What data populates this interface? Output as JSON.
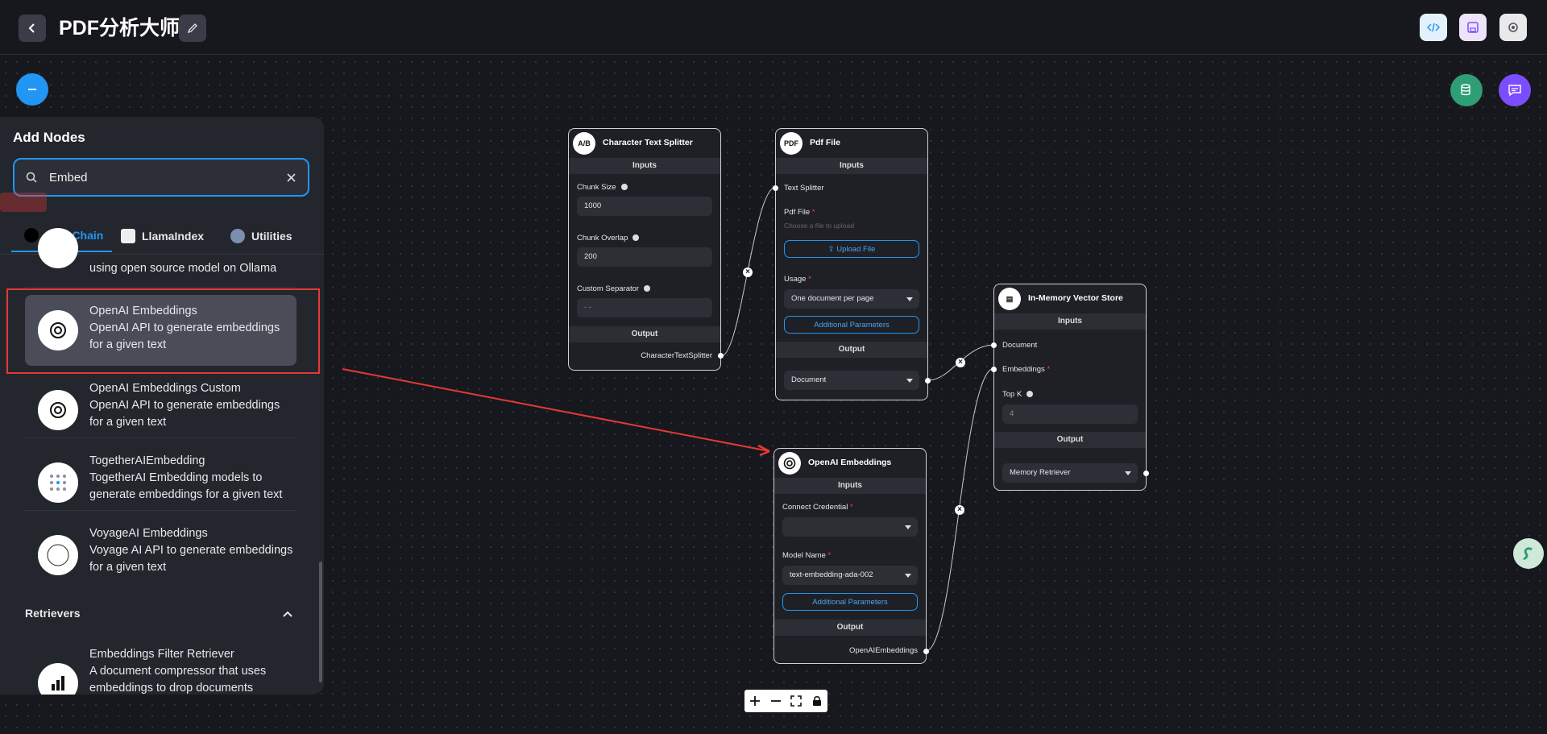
{
  "header": {
    "title": "PDF分析大师"
  },
  "panel": {
    "title": "Add Nodes",
    "search_value": "Embed",
    "tabs": [
      {
        "label": "LangChain",
        "active": true
      },
      {
        "label": "LlamaIndex",
        "active": false
      },
      {
        "label": "Utilities",
        "active": false
      }
    ],
    "items": [
      {
        "name": "",
        "desc": "using open source model on Ollama",
        "icon": "ollama-icon"
      },
      {
        "name": "OpenAI Embeddings",
        "desc": "OpenAI API to generate embeddings for a given text",
        "icon": "openai-icon"
      },
      {
        "name": "OpenAI Embeddings Custom",
        "desc": "OpenAI API to generate embeddings for a given text",
        "icon": "openai-icon"
      },
      {
        "name": "TogetherAIEmbedding",
        "desc": "TogetherAI Embedding models to generate embeddings for a given text",
        "icon": "togetherai-icon"
      },
      {
        "name": "VoyageAI Embeddings",
        "desc": "Voyage AI API to generate embeddings for a given text",
        "icon": "voyageai-icon"
      }
    ],
    "retrievers_section": "Retrievers",
    "retriever_item": {
      "name": "Embeddings Filter Retriever",
      "desc": "A document compressor that uses embeddings to drop documents"
    }
  },
  "nodes": {
    "splitter": {
      "title": "Character Text Splitter",
      "inputs": "Inputs",
      "chunk_size_label": "Chunk Size",
      "chunk_size": "1000",
      "chunk_overlap_label": "Chunk Overlap",
      "chunk_overlap": "200",
      "separator_label": "Custom Separator",
      "separator_placeholder": "- -",
      "output": "Output",
      "output_name": "CharacterTextSplitter"
    },
    "pdf": {
      "title": "Pdf File",
      "inputs": "Inputs",
      "text_splitter_label": "Text Splitter",
      "pdf_file_label": "Pdf File",
      "pdf_placeholder": "Choose a file to upload",
      "upload_label": "Upload File",
      "usage_label": "Usage",
      "usage_value": "One document per page",
      "additional": "Additional Parameters",
      "output": "Output",
      "output_value": "Document"
    },
    "vector": {
      "title": "In-Memory Vector Store",
      "inputs": "Inputs",
      "document_label": "Document",
      "embeddings_label": "Embeddings",
      "topk_label": "Top K",
      "topk_value": "4",
      "output": "Output",
      "output_value": "Memory Retriever"
    },
    "openai": {
      "title": "OpenAI Embeddings",
      "inputs": "Inputs",
      "credential_label": "Connect Credential",
      "model_label": "Model Name",
      "model_value": "text-embedding-ada-002",
      "additional": "Additional Parameters",
      "output": "Output",
      "output_name": "OpenAIEmbeddings"
    }
  },
  "colors": {
    "accent": "#2196f3",
    "highlight": "#e53935",
    "green": "#2e9e76",
    "purple": "#7c4dff"
  }
}
